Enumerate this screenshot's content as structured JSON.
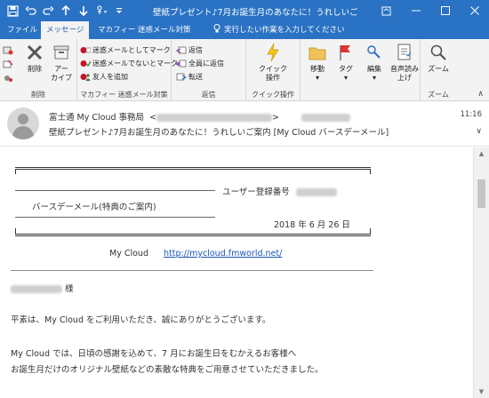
{
  "window": {
    "title": "壁紙プレゼント♪7月お誕生月のあなたに！うれしいご案内 [M..."
  },
  "tabs": [
    {
      "label": "ファイル"
    },
    {
      "label": "メッセージ"
    },
    {
      "label": "マカフィー 迷惑メール対策"
    }
  ],
  "tellme": {
    "text": "実行したい作業を入力してください"
  },
  "ribbon": {
    "delete_group": {
      "label": "削除",
      "delete": "削除",
      "archive": "アー\nカイブ"
    },
    "mcafee_group": {
      "label": "マカフィー 迷惑メール対策",
      "mark_spam": "迷惑メールとしてマーク",
      "mark_not_spam": "迷惑メールでないとマーク",
      "add_friend": "友人を追加"
    },
    "reply_group": {
      "label": "返信",
      "reply": "返信",
      "reply_all": "全員に返信",
      "forward": "転送"
    },
    "quick_group": {
      "label": "クイック操作",
      "quick_steps": "クイック\n操作"
    },
    "move_group": {
      "move": "移動",
      "tags": "タグ",
      "editing": "編集",
      "read_aloud": "音声読み\n上げ"
    },
    "zoom_group": {
      "label": "ズーム",
      "zoom": "ズーム"
    }
  },
  "message": {
    "sender_name": "富士通 My Cloud 事務局",
    "time": "11:16",
    "subject": "壁紙プレゼント♪7月お誕生月のあなたに！うれしいご案内 [My Cloud バースデーメール]"
  },
  "body": {
    "user_reg_label": "ユーザー登録番号",
    "birthday_mail": "バースデーメール(特典のご案内)",
    "date": "2018 年 6 月 26 日",
    "mycloud_label": "My Cloud",
    "mycloud_url": "http://mycloud.fmworld.net/",
    "honorific": "様",
    "para1": "平素は、My Cloud をご利用いただき、誠にありがとうございます。",
    "para2_line1": "My Cloud では、日頃の感謝を込めて、7 月にお誕生日をむかえるお客様へ",
    "para2_line2": "お誕生月だけのオリジナル壁紙などの素敵な特典をご用意させていただきました。"
  },
  "colors": {
    "accent": "#2a72c4",
    "link": "#1a56b8"
  }
}
